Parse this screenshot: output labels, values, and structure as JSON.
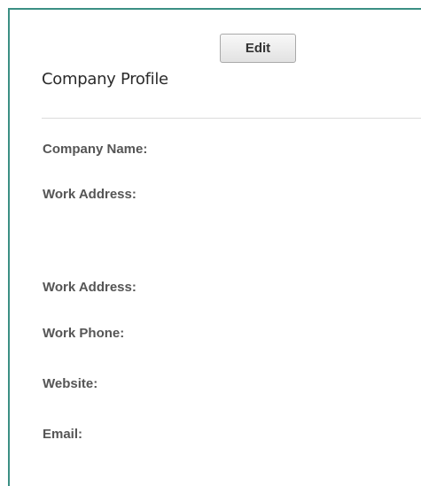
{
  "profile": {
    "edit_label": "Edit",
    "title": "Company Profile",
    "fields": [
      {
        "label": "Company Name:"
      },
      {
        "label": "Work Address:"
      },
      {
        "label": "Work Address:"
      },
      {
        "label": "Work Phone:"
      },
      {
        "label": "Website:"
      },
      {
        "label": "Email:"
      }
    ]
  },
  "colors": {
    "border_accent": "#3b8f84",
    "label_text": "#555555",
    "title_text": "#2b2b2b"
  }
}
